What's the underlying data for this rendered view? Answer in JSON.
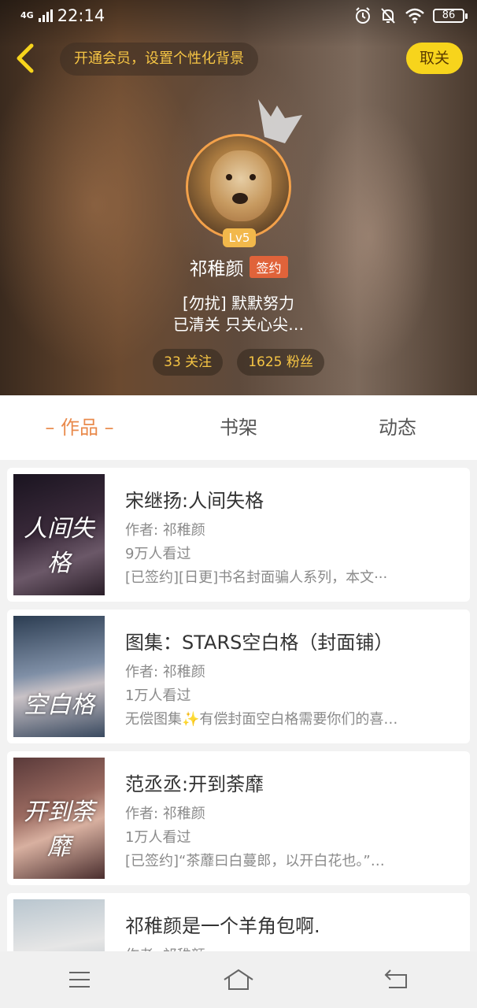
{
  "status_bar": {
    "network": "4G",
    "time": "22:14",
    "battery": "86"
  },
  "header": {
    "vip_banner": "开通会员，设置个性化背景",
    "unfollow_label": "取关",
    "level": "Lv5",
    "username": "祁稚颜",
    "signed_badge": "签约",
    "bio_line1": "[勿扰] 默默努力",
    "bio_line2": "已清关 只关心尖…",
    "following": "33 关注",
    "followers": "1625 粉丝"
  },
  "tabs": [
    {
      "label": "– 作品 –",
      "active": true
    },
    {
      "label": "书架",
      "active": false
    },
    {
      "label": "动态",
      "active": false
    }
  ],
  "books": [
    {
      "title": "宋继扬:人间失格",
      "author": "作者: 祁稚颜",
      "views": "9万人看过",
      "desc": "[已签约][日更]书名封面骗人系列，本文···",
      "cover_text": "人间失格"
    },
    {
      "title": "图集：STARS空白格（封面铺）",
      "author": "作者: 祁稚颜",
      "views": "1万人看过",
      "desc": "无偿图集✨有偿封面空白格需要你们的喜…",
      "cover_text": "空白格"
    },
    {
      "title": "范丞丞:开到荼靡",
      "author": "作者: 祁稚颜",
      "views": "1万人看过",
      "desc": "[已签约]“茶蘼曰白蔓郎，以开白花也。”…",
      "cover_text": "开到荼靡"
    },
    {
      "title": "祁稚颜是一个羊角包啊.",
      "author": "作者: 祁稚颜",
      "views": "",
      "desc": "",
      "cover_text": ""
    }
  ]
}
